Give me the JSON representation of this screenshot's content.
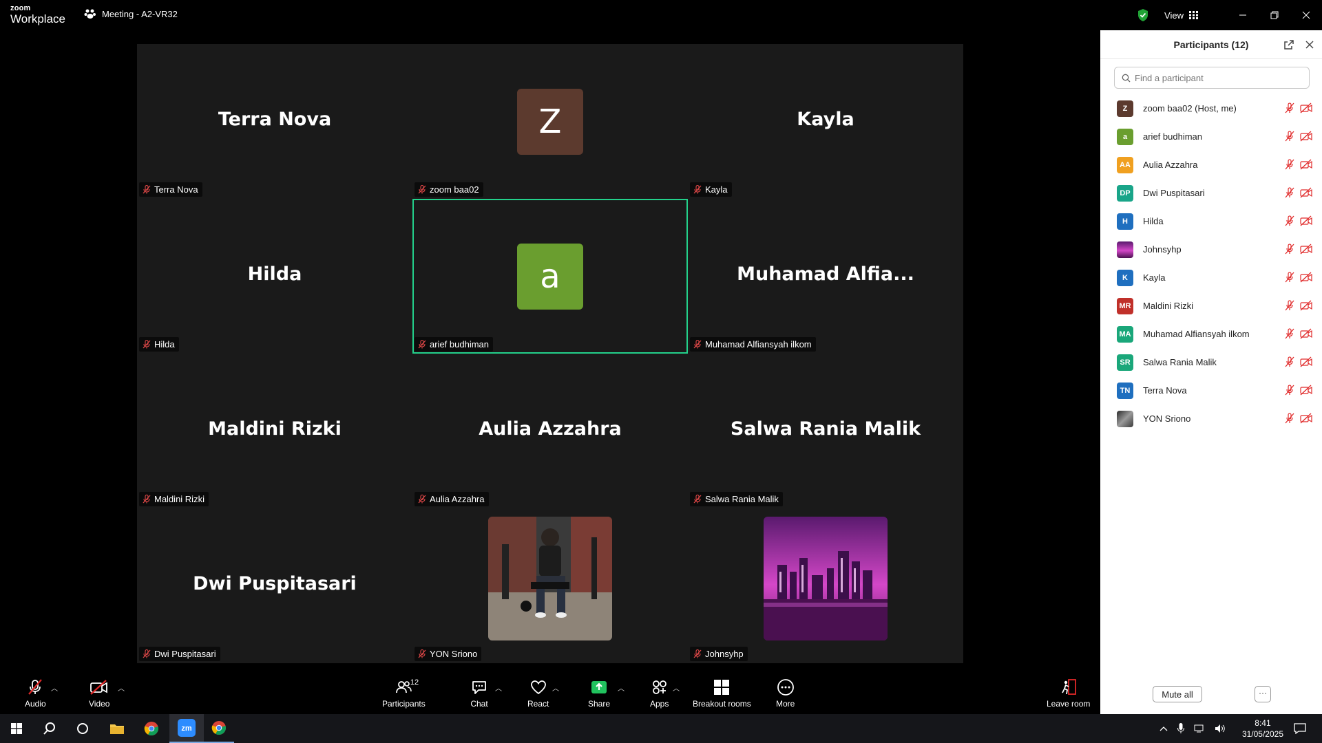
{
  "app": {
    "brand_top": "zoom",
    "brand_bottom": "Workplace",
    "meeting_title": "Meeting - A2-VR32",
    "view_label": "View",
    "shield_color": "#21a336"
  },
  "tiles": [
    {
      "big": "Terra Nova",
      "label": "Terra Nova"
    },
    {
      "big": "",
      "label": "zoom baa02",
      "avatar_letter": "Z",
      "avatar_color": "#5c3a2e"
    },
    {
      "big": "Kayla",
      "label": "Kayla"
    },
    {
      "big": "Hilda",
      "label": "Hilda"
    },
    {
      "big": "",
      "label": "arief budhiman",
      "avatar_letter": "a",
      "avatar_color": "#6a9e2f",
      "active": true
    },
    {
      "big": "Muhamad  Alfia...",
      "label": "Muhamad Alfiansyah ilkom"
    },
    {
      "big": "Maldini Rizki",
      "label": "Maldini Rizki"
    },
    {
      "big": "Aulia Azzahra",
      "label": "Aulia Azzahra"
    },
    {
      "big": "Salwa Rania Malik",
      "label": "Salwa Rania Malik"
    },
    {
      "big": "Dwi Puspitasari",
      "label": "Dwi Puspitasari"
    },
    {
      "big": "",
      "label": "YON Sriono",
      "photo": "gym-photo"
    },
    {
      "big": "",
      "label": "Johnsyhp",
      "photo": "city-photo"
    }
  ],
  "panel": {
    "title": "Participants (12)",
    "search_placeholder": "Find a participant",
    "mute_all": "Mute all",
    "more": "···",
    "participants": [
      {
        "initials": "Z",
        "name": "zoom baa02 (Host, me)",
        "color": "#5c3a2e"
      },
      {
        "initials": "a",
        "name": "arief budhiman",
        "color": "#6a9e2f"
      },
      {
        "initials": "AA",
        "name": "Aulia Azzahra",
        "color": "#f0a020"
      },
      {
        "initials": "DP",
        "name": "Dwi Puspitasari",
        "color": "#19a589"
      },
      {
        "initials": "H",
        "name": "Hilda",
        "color": "#1f6fbf"
      },
      {
        "initials": "",
        "name": "Johnsyhp",
        "color": "#8a2fa0",
        "photo": true
      },
      {
        "initials": "K",
        "name": "Kayla",
        "color": "#1f6fbf"
      },
      {
        "initials": "MR",
        "name": "Maldini Rizki",
        "color": "#c0302a"
      },
      {
        "initials": "MA",
        "name": "Muhamad Alfiansyah ilkom",
        "color": "#1aa77a"
      },
      {
        "initials": "SR",
        "name": "Salwa Rania Malik",
        "color": "#1aa77a"
      },
      {
        "initials": "TN",
        "name": "Terra Nova",
        "color": "#1f6fbf"
      },
      {
        "initials": "",
        "name": "YON Sriono",
        "color": "#555555",
        "photo": true
      }
    ]
  },
  "toolbar": {
    "audio": "Audio",
    "video": "Video",
    "participants": "Participants",
    "participants_count": "12",
    "chat": "Chat",
    "react": "React",
    "share": "Share",
    "apps": "Apps",
    "breakout": "Breakout rooms",
    "more": "More",
    "leave": "Leave room"
  },
  "taskbar": {
    "time": "8:41",
    "date": "31/05/2025"
  }
}
